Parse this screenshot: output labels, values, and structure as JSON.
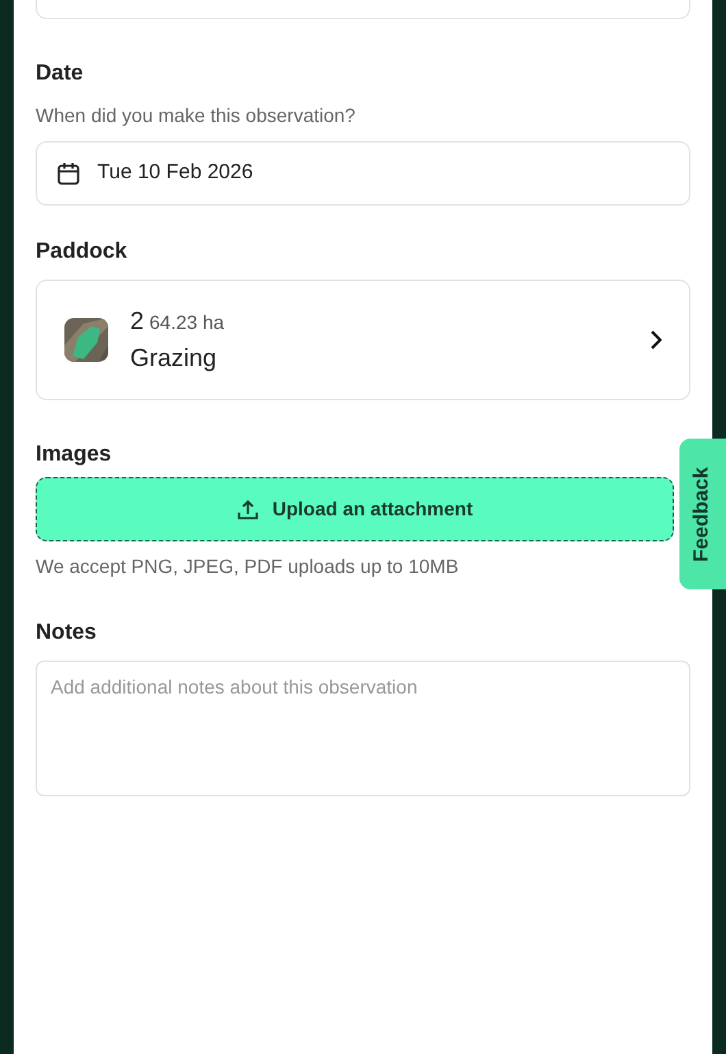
{
  "date": {
    "label": "Date",
    "help": "When did you make this observation?",
    "value": "Tue 10 Feb 2026"
  },
  "paddock": {
    "label": "Paddock",
    "name": "2",
    "area": "64.23 ha",
    "use": "Grazing"
  },
  "images": {
    "label": "Images",
    "button": "Upload an attachment",
    "hint": "We accept PNG, JPEG, PDF uploads up to 10MB"
  },
  "notes": {
    "label": "Notes",
    "placeholder": "Add additional notes about this observation"
  },
  "feedback_tab": "Feedback"
}
